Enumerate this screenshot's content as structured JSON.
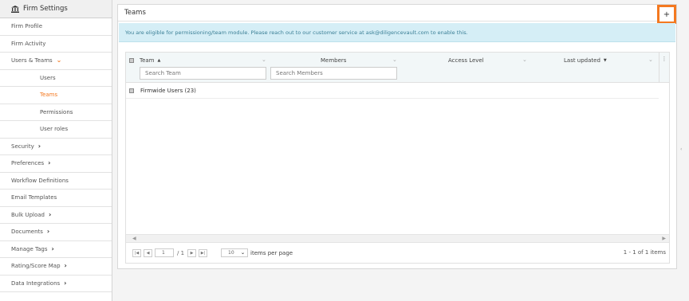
{
  "sidebar": {
    "header": "Firm Settings",
    "items": [
      {
        "label": "Firm Profile"
      },
      {
        "label": "Firm Activity"
      },
      {
        "label": "Users & Teams"
      },
      {
        "label": "Users"
      },
      {
        "label": "Teams"
      },
      {
        "label": "Permissions"
      },
      {
        "label": "User roles"
      },
      {
        "label": "Security"
      },
      {
        "label": "Preferences"
      },
      {
        "label": "Workflow Definitions"
      },
      {
        "label": "Email Templates"
      },
      {
        "label": "Bulk Upload"
      },
      {
        "label": "Documents"
      },
      {
        "label": "Manage Tags"
      },
      {
        "label": "Rating/Score Map"
      },
      {
        "label": "Data Integrations"
      }
    ]
  },
  "panel": {
    "title": "Teams",
    "add_label": "+",
    "notice": "You are eligible for permissioning/team module. Please reach out to our customer service at ask@diligencevault.com to enable this."
  },
  "grid": {
    "columns": {
      "team": "Team",
      "members": "Members",
      "access": "Access Level",
      "updated": "Last updated"
    },
    "sort_up": "▲",
    "sort_down": "▼",
    "menu": "⋮",
    "filters": {
      "team_placeholder": "Search Team",
      "members_placeholder": "Search Members"
    },
    "group_label": "Firmwide Users (23)"
  },
  "pager": {
    "first": "|◀",
    "prev": "◀",
    "page": "1",
    "of_total": "/ 1",
    "next": "▶",
    "last": "▶|",
    "per_page_value": "10",
    "per_page_label": "items per page",
    "info": "1 - 1 of 1 items"
  },
  "colors": {
    "accent": "#f47920",
    "notice_bg": "#d5eef6",
    "notice_text": "#3a7f96"
  }
}
